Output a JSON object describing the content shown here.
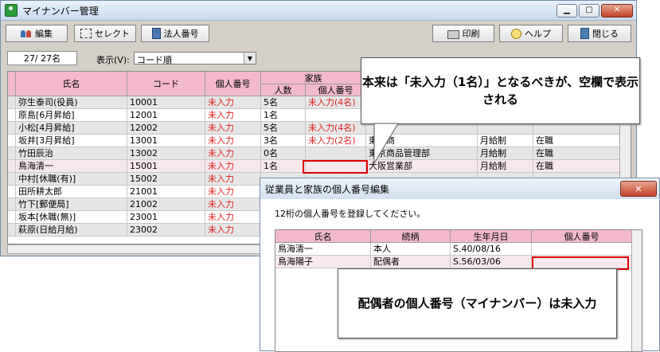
{
  "window": {
    "title": "マイナンバー管理",
    "controls": {
      "minimize": "▁",
      "maximize": "▢",
      "close": "✕"
    }
  },
  "toolbar": {
    "edit": "編集",
    "select": "セレクト",
    "corp": "法人番号",
    "print": "印刷",
    "help": "ヘルプ",
    "close": "閉じる"
  },
  "status": {
    "count": "27/ 27名",
    "display_label": "表示(V):",
    "sort_value": "コード順",
    "dropdown_arrow": "▼"
  },
  "grid": {
    "headers": {
      "name": "氏名",
      "code": "コード",
      "mynumber": "個人番号",
      "family": "家族",
      "family_count": "人数",
      "family_mynumber": "個人番号"
    },
    "rows": [
      {
        "name": "弥生泰司(役員)",
        "code": "10001",
        "mynumber": "未入力",
        "family_count": "5名",
        "family_mynumber": "未入力(4名)",
        "dept": "",
        "pay": "",
        "status": ""
      },
      {
        "name": "原島[6月昇給]",
        "code": "12001",
        "mynumber": "未入力",
        "family_count": "1名",
        "family_mynumber": "",
        "dept": "",
        "pay": "",
        "status": ""
      },
      {
        "name": "小松[4月昇給]",
        "code": "12002",
        "mynumber": "未入力",
        "family_count": "5名",
        "family_mynumber": "未入力(4名)",
        "dept": "",
        "pay": "",
        "status": ""
      },
      {
        "name": "坂井[3月昇給]",
        "code": "13001",
        "mynumber": "未入力",
        "family_count": "3名",
        "family_mynumber": "未入力(2名)",
        "dept": "東京商",
        "pay": "月給制",
        "status": "在職"
      },
      {
        "name": "竹田辰治",
        "code": "13002",
        "mynumber": "未入力",
        "family_count": "0名",
        "family_mynumber": "",
        "dept": "東京商品管理部",
        "pay": "月給制",
        "status": "在職"
      },
      {
        "name": "鳥海清一",
        "code": "15001",
        "mynumber": "未入力",
        "family_count": "1名",
        "family_mynumber": "",
        "dept": "大阪営業部",
        "pay": "月給制",
        "status": "在職"
      },
      {
        "name": "中村[休職(有)]",
        "code": "15002",
        "mynumber": "未入力",
        "family_count": "",
        "family_mynumber": "",
        "dept": "",
        "pay": "",
        "status": ""
      },
      {
        "name": "田所耕太郎",
        "code": "21001",
        "mynumber": "未入力",
        "family_count": "",
        "family_mynumber": "",
        "dept": "",
        "pay": "",
        "status": ""
      },
      {
        "name": "竹下[郵便局]",
        "code": "21002",
        "mynumber": "未入力",
        "family_count": "",
        "family_mynumber": "",
        "dept": "",
        "pay": "",
        "status": ""
      },
      {
        "name": "坂本[休職(無)]",
        "code": "23001",
        "mynumber": "未入力",
        "family_count": "",
        "family_mynumber": "",
        "dept": "",
        "pay": "",
        "status": ""
      },
      {
        "name": "萩原(日給月給)",
        "code": "23002",
        "mynumber": "未入力",
        "family_count": "",
        "family_mynumber": "",
        "dept": "",
        "pay": "",
        "status": ""
      }
    ]
  },
  "callout_top": {
    "text": "本来は「未入力（1名）」となるべきが、空欄で表示される"
  },
  "callout_bottom": {
    "text": "配偶者の個人番号（マイナンバー）は未入力"
  },
  "dialog": {
    "title": "従業員と家族の個人番号編集",
    "close": "✕",
    "message": "12桁の個人番号を登録してください。",
    "headers": {
      "name": "氏名",
      "relation": "続柄",
      "birth": "生年月日",
      "mynumber": "個人番号"
    },
    "rows": [
      {
        "name": "鳥海清一",
        "relation": "本人",
        "birth": "S.40/08/16",
        "mynumber": ""
      },
      {
        "name": "鳥海陽子",
        "relation": "配偶者",
        "birth": "S.56/03/06",
        "mynumber": ""
      }
    ]
  },
  "colors": {
    "header_pink": "#f2b8cc",
    "missing_red": "#e02020",
    "outline_red": "#e00000"
  }
}
